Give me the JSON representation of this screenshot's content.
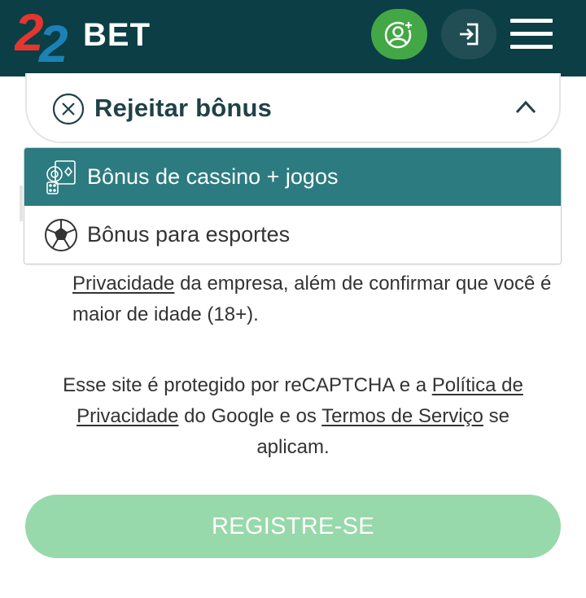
{
  "header": {
    "logo_text": "22BET",
    "colors": {
      "bg": "#0b3e45",
      "register_icon_bg": "#44a745",
      "login_icon_bg": "#214e55"
    },
    "icons": [
      "add-user-icon",
      "login-icon",
      "hamburger-menu-icon"
    ]
  },
  "bonus_select": {
    "selected_label": "Rejeitar bônus",
    "icon": "x-circle-icon",
    "chevron": "chevron-up-icon"
  },
  "dropdown": {
    "options": [
      {
        "label": "Bônus de cassino + jogos",
        "icon": "casino-chips-icon",
        "selected": true
      },
      {
        "label": "Bônus para esportes",
        "icon": "soccer-ball-icon",
        "selected": false
      }
    ],
    "selected_color": "#2c7b80"
  },
  "privacy": {
    "link": "Privacidade",
    "text_1": " da empresa, além de confirmar que você é maior de idade (18+)."
  },
  "captcha": {
    "text_1": "Esse site é protegido por reCAPTCHA e a ",
    "link_1": "Política de Privacidade",
    "text_2": " do Google e os ",
    "link_2": "Termos de Serviço",
    "text_3": " se aplicam."
  },
  "register_button": {
    "label": "REGISTRE-SE",
    "color": "#97d9aa"
  }
}
